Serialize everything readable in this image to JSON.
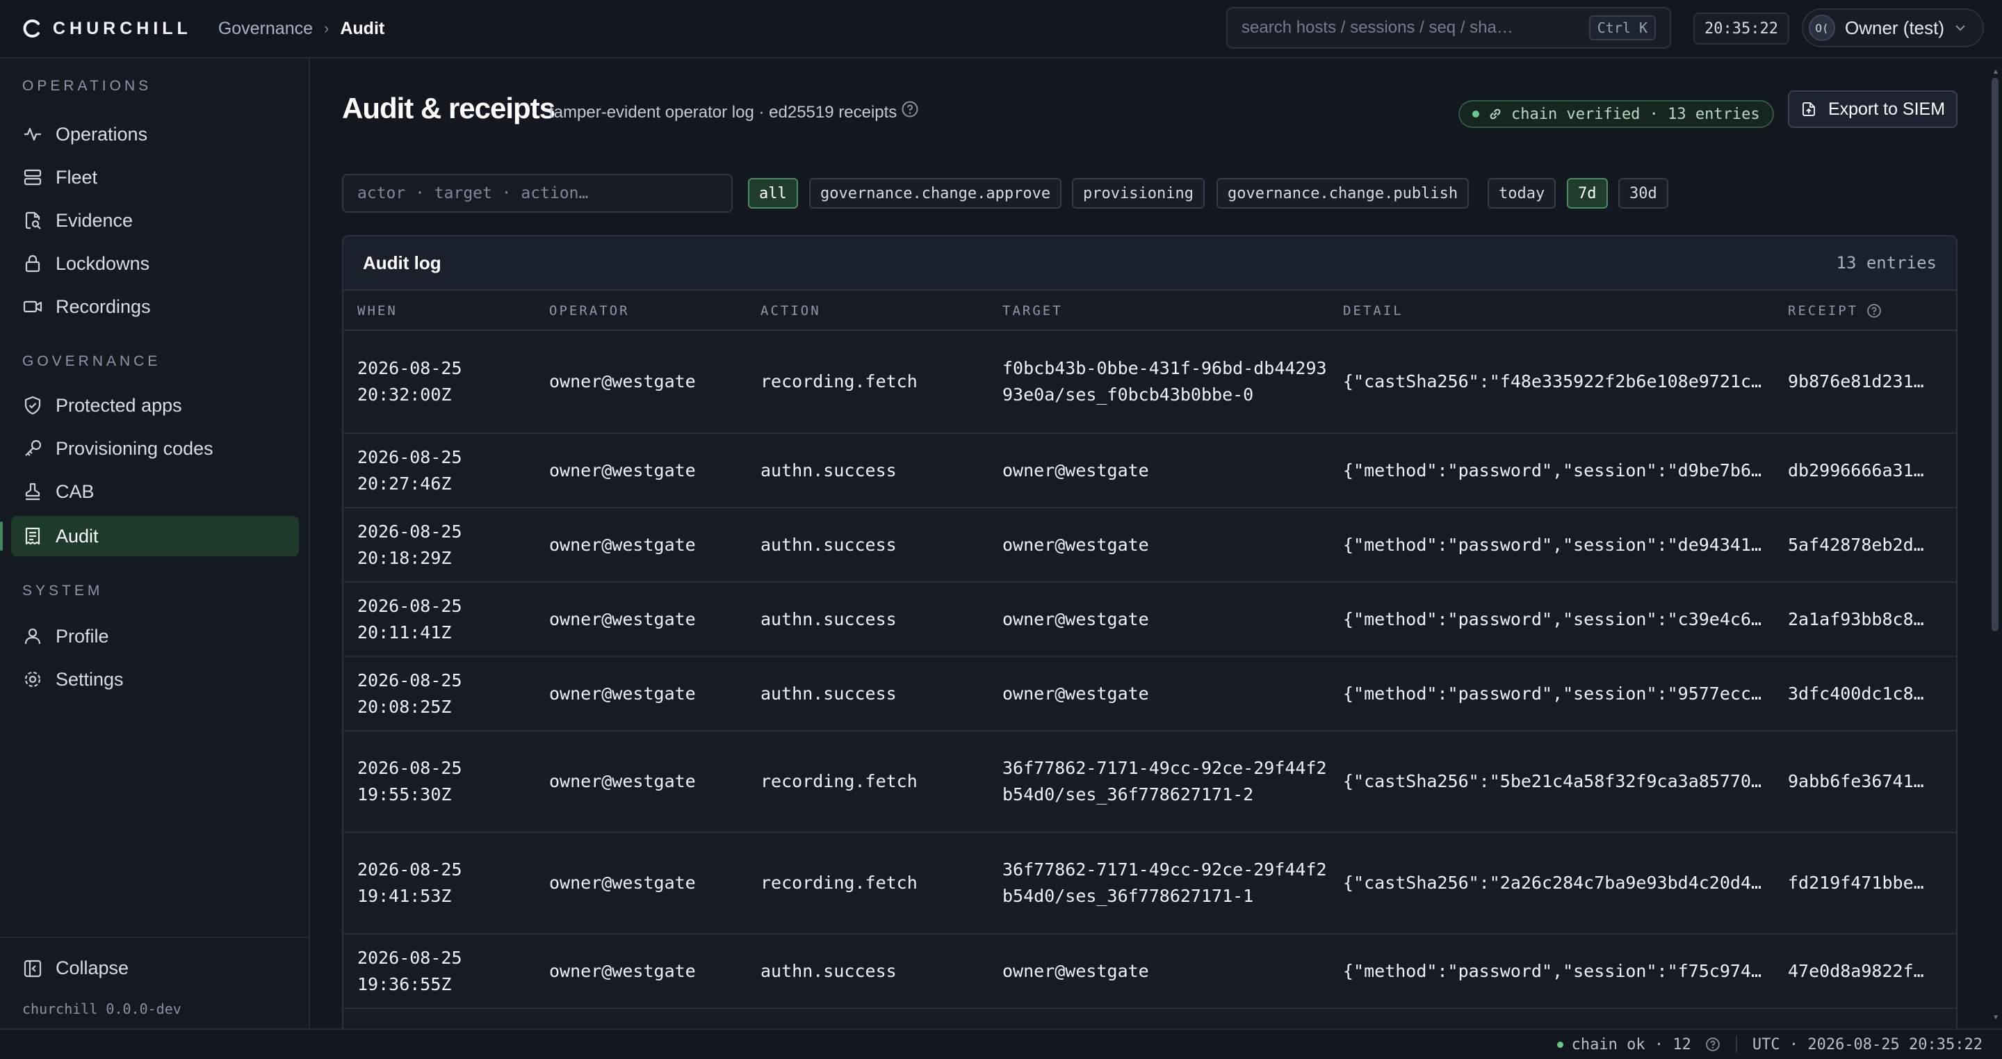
{
  "app": {
    "name": "CHURCHILL",
    "version": "churchill 0.0.0-dev"
  },
  "breadcrumb": {
    "parent": "Governance",
    "separator": "›",
    "current": "Audit"
  },
  "search": {
    "placeholder": "search hosts / sessions / seq / sha…",
    "shortcut": "Ctrl K"
  },
  "clock": "20:35:22",
  "user": {
    "initials": "O(",
    "name": "Owner (test)"
  },
  "sidebar": {
    "sections": [
      {
        "title": "OPERATIONS",
        "items": [
          {
            "label": "Operations",
            "icon": "pulse-icon"
          },
          {
            "label": "Fleet",
            "icon": "server-icon"
          },
          {
            "label": "Evidence",
            "icon": "file-search-icon"
          },
          {
            "label": "Lockdowns",
            "icon": "lock-icon"
          },
          {
            "label": "Recordings",
            "icon": "video-icon"
          }
        ]
      },
      {
        "title": "GOVERNANCE",
        "items": [
          {
            "label": "Protected apps",
            "icon": "shield-check-icon"
          },
          {
            "label": "Provisioning codes",
            "icon": "key-icon"
          },
          {
            "label": "CAB",
            "icon": "stamp-icon"
          },
          {
            "label": "Audit",
            "icon": "receipt-icon",
            "active": true
          }
        ]
      },
      {
        "title": "SYSTEM",
        "items": [
          {
            "label": "Profile",
            "icon": "user-icon"
          },
          {
            "label": "Settings",
            "icon": "gear-icon"
          }
        ]
      }
    ],
    "collapse_label": "Collapse"
  },
  "page": {
    "title": "Audit & receipts",
    "subtitle": "tamper-evident operator log · ed25519 receipts",
    "chain_badge": "chain verified · 13 entries",
    "export_label": "Export to SIEM"
  },
  "filters": {
    "placeholder": "actor · target · action…",
    "actions": [
      "all",
      "governance.change.approve",
      "provisioning",
      "governance.change.publish"
    ],
    "active_action": "all",
    "ranges": [
      "today",
      "7d",
      "30d"
    ],
    "active_range": "7d"
  },
  "table": {
    "title": "Audit log",
    "count": "13 entries",
    "columns": [
      "WHEN",
      "OPERATOR",
      "ACTION",
      "TARGET",
      "DETAIL",
      "RECEIPT"
    ],
    "rows": [
      {
        "when": "2026-08-25 20:32:00Z",
        "operator": "owner@westgate",
        "action": "recording.fetch",
        "target": "f0bcb43b-0bbe-431f-96bd-db4429393e0a/ses_f0bcb43b0bbe-0",
        "detail": "{\"castSha256\":\"f48e335922f2b6e108e9721c…",
        "receipt": "9b876e81d231…"
      },
      {
        "when": "2026-08-25 20:27:46Z",
        "operator": "owner@westgate",
        "action": "authn.success",
        "target": "owner@westgate",
        "detail": "{\"method\":\"password\",\"session\":\"d9be7b6…",
        "receipt": "db2996666a31…"
      },
      {
        "when": "2026-08-25 20:18:29Z",
        "operator": "owner@westgate",
        "action": "authn.success",
        "target": "owner@westgate",
        "detail": "{\"method\":\"password\",\"session\":\"de94341…",
        "receipt": "5af42878eb2d…"
      },
      {
        "when": "2026-08-25 20:11:41Z",
        "operator": "owner@westgate",
        "action": "authn.success",
        "target": "owner@westgate",
        "detail": "{\"method\":\"password\",\"session\":\"c39e4c6…",
        "receipt": "2a1af93bb8c8…"
      },
      {
        "when": "2026-08-25 20:08:25Z",
        "operator": "owner@westgate",
        "action": "authn.success",
        "target": "owner@westgate",
        "detail": "{\"method\":\"password\",\"session\":\"9577ecc…",
        "receipt": "3dfc400dc1c8…"
      },
      {
        "when": "2026-08-25 19:55:30Z",
        "operator": "owner@westgate",
        "action": "recording.fetch",
        "target": "36f77862-7171-49cc-92ce-29f44f2b54d0/ses_36f778627171-2",
        "detail": "{\"castSha256\":\"5be21c4a58f32f9ca3a85770…",
        "receipt": "9abb6fe36741…"
      },
      {
        "when": "2026-08-25 19:41:53Z",
        "operator": "owner@westgate",
        "action": "recording.fetch",
        "target": "36f77862-7171-49cc-92ce-29f44f2b54d0/ses_36f778627171-1",
        "detail": "{\"castSha256\":\"2a26c284c7ba9e93bd4c20d4…",
        "receipt": "fd219f471bbe…"
      },
      {
        "when": "2026-08-25 19:36:55Z",
        "operator": "owner@westgate",
        "action": "authn.success",
        "target": "owner@westgate",
        "detail": "{\"method\":\"password\",\"session\":\"f75c974…",
        "receipt": "47e0d8a9822f…"
      }
    ]
  },
  "statusbar": {
    "chain": "chain ok · 12",
    "time": "UTC · 2026-08-25 20:35:22"
  },
  "colors": {
    "accent": "#3f8a5c",
    "ok": "#67c98a",
    "background": "#131720"
  }
}
